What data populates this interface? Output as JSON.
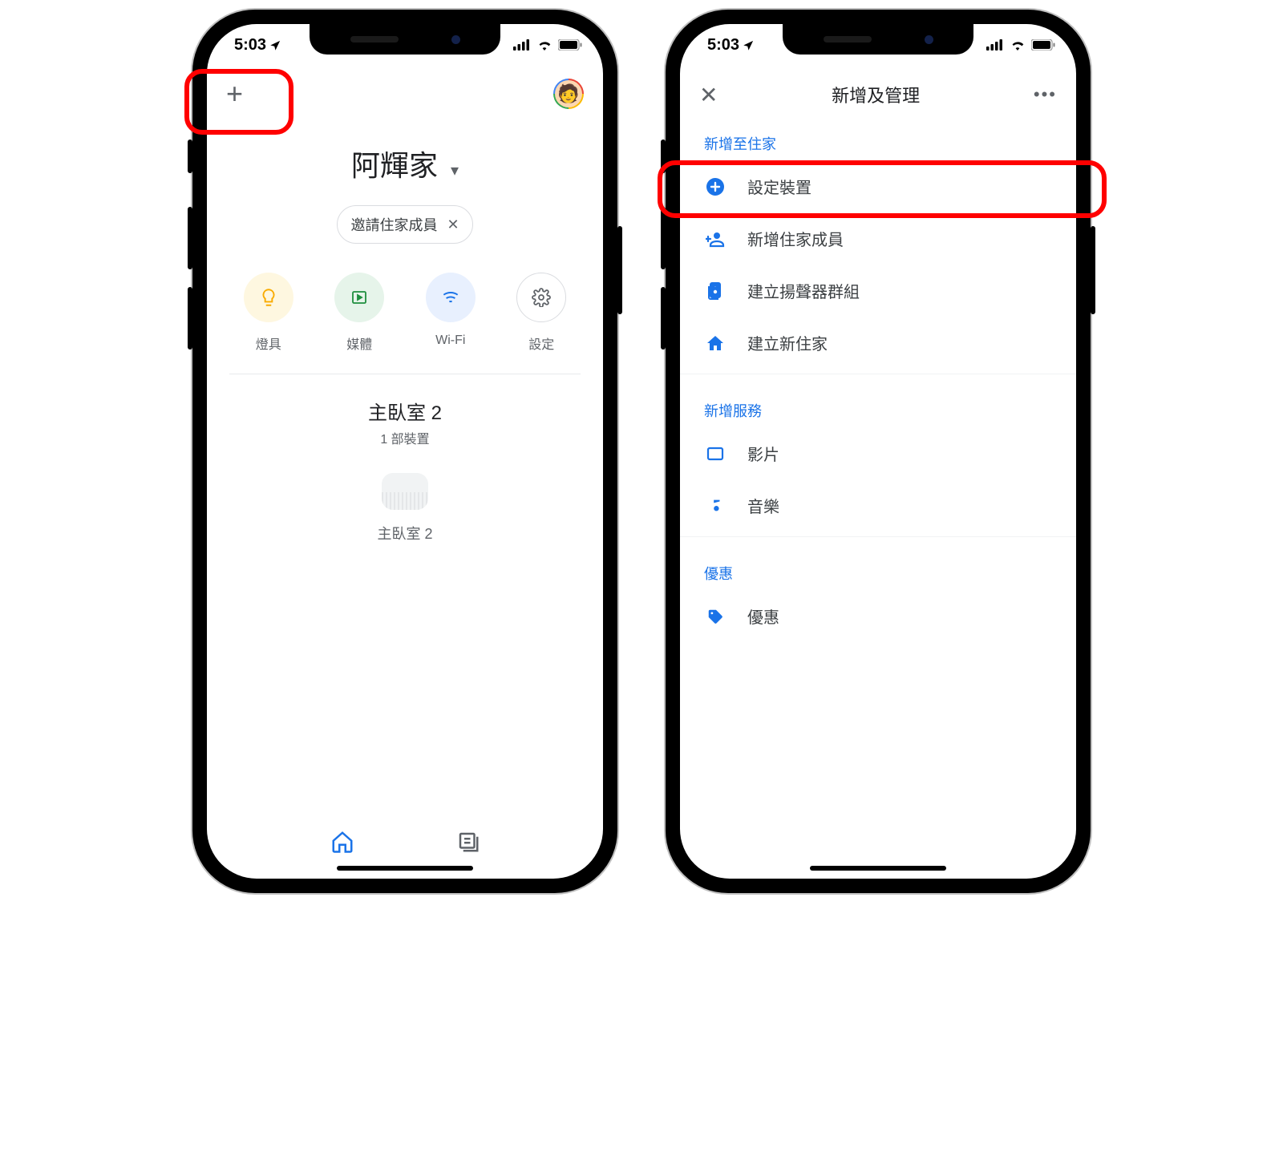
{
  "status": {
    "time": "5:03"
  },
  "screen1": {
    "home_name": "阿輝家",
    "invite_label": "邀請住家成員",
    "quick": {
      "light": "燈具",
      "media": "媒體",
      "wifi": "Wi-Fi",
      "settings": "設定"
    },
    "room": {
      "title": "主臥室 2",
      "subtitle": "1 部裝置",
      "device_label": "主臥室 2"
    }
  },
  "screen2": {
    "title": "新增及管理",
    "section_add_home": "新增至住家",
    "item_setup_device": "設定裝置",
    "item_add_member": "新增住家成員",
    "item_speaker_group": "建立揚聲器群組",
    "item_new_home": "建立新住家",
    "section_services": "新增服務",
    "item_video": "影片",
    "item_music": "音樂",
    "section_offers": "優惠",
    "item_offers": "優惠"
  }
}
